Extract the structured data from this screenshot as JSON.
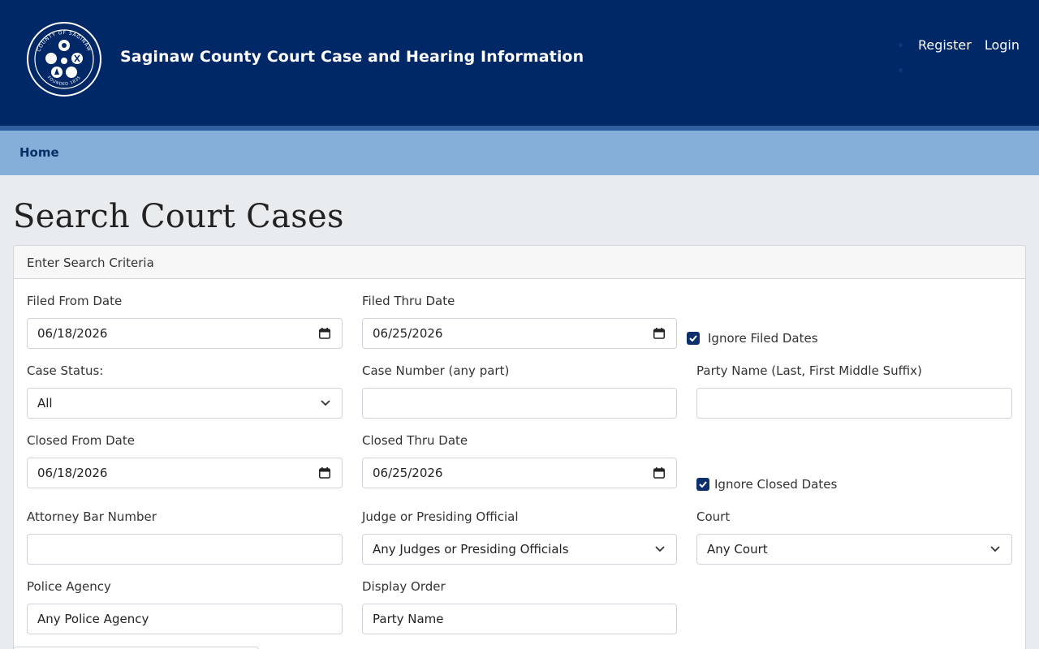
{
  "header": {
    "title": "Saginaw County Court Case and Hearing Information",
    "seal_top_text": "COUNTY OF SAGINAW",
    "seal_bottom_text": "FOUNDED 1835",
    "brand_color": "#002866",
    "nav": {
      "register": "Register",
      "login": "Login"
    }
  },
  "navbar": {
    "home": "Home",
    "color": "#85afd8"
  },
  "page": {
    "title": "Search Court Cases"
  },
  "form": {
    "card_title": "Enter Search Criteria",
    "filed_from": {
      "label": "Filed From Date",
      "value": "06/18/2026",
      "icon": "calendar-icon"
    },
    "filed_thru": {
      "label": "Filed Thru Date",
      "value": "06/25/2026",
      "icon": "calendar-icon"
    },
    "ignore_filed": {
      "label": "Ignore Filed Dates",
      "checked": true
    },
    "case_status": {
      "label": "Case Status:",
      "value": "All"
    },
    "case_number": {
      "label": "Case Number (any part)",
      "value": ""
    },
    "party_name": {
      "label": "Party Name (Last, First Middle Suffix)",
      "value": ""
    },
    "closed_from": {
      "label": "Closed From Date",
      "value": "06/18/2026",
      "icon": "calendar-icon"
    },
    "closed_thru": {
      "label": "Closed Thru Date",
      "value": "06/25/2026",
      "icon": "calendar-icon"
    },
    "ignore_closed": {
      "label": "Ignore Closed Dates",
      "checked": true
    },
    "attorney_bar": {
      "label": "Attorney Bar Number",
      "value": ""
    },
    "judge": {
      "label": "Judge or Presiding Official",
      "value": "Any Judges or Presiding Officials"
    },
    "court": {
      "label": "Court",
      "value": "Any Court"
    },
    "police_agency": {
      "label": "Police Agency",
      "value": "Any Police Agency"
    },
    "display_order": {
      "label": "Display Order",
      "value": "Party Name"
    }
  }
}
